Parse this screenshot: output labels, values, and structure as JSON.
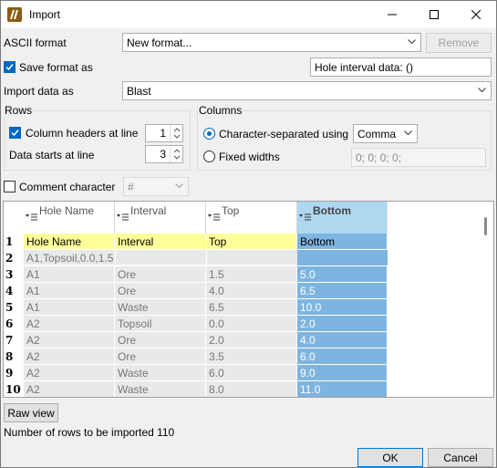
{
  "window": {
    "title": "Import"
  },
  "ascii_format": {
    "label": "ASCII format",
    "value": "New format...",
    "remove_label": "Remove"
  },
  "save_format": {
    "label": "Save format as",
    "checked": true,
    "name_value": "Hole interval data: ()"
  },
  "import_data": {
    "label": "Import data as",
    "value": "Blast"
  },
  "rows": {
    "title": "Rows",
    "column_headers_label": "Column headers at line",
    "column_headers_checked": true,
    "column_headers_value": "1",
    "data_starts_label": "Data starts at line",
    "data_starts_value": "3"
  },
  "columns": {
    "title": "Columns",
    "char_sep_label": "Character-separated using",
    "char_sep_value": "Comma",
    "fixed_widths_label": "Fixed widths",
    "fixed_widths_value": "0; 0; 0; 0;",
    "selected": "character-separated"
  },
  "comment": {
    "label": "Comment character",
    "checked": false,
    "value": "#"
  },
  "grid": {
    "headers": [
      "Hole Name",
      "Interval",
      "Top",
      "Bottom"
    ],
    "selected_column": 3,
    "rows": [
      {
        "n": "1",
        "cells": [
          "Hole Name",
          "Interval",
          "Top",
          "Bottom"
        ],
        "type": "header"
      },
      {
        "n": "2",
        "cells": [
          "A1,Topsoil,0.0,1.5",
          "",
          "",
          ""
        ],
        "type": "raw"
      },
      {
        "n": "3",
        "cells": [
          "A1",
          "Ore",
          "1.5",
          "5.0"
        ],
        "type": "data"
      },
      {
        "n": "4",
        "cells": [
          "A1",
          "Ore",
          "4.0",
          "6.5"
        ],
        "type": "data"
      },
      {
        "n": "5",
        "cells": [
          "A1",
          "Waste",
          "6.5",
          "10.0"
        ],
        "type": "data"
      },
      {
        "n": "6",
        "cells": [
          "A2",
          "Topsoil",
          "0.0",
          "2.0"
        ],
        "type": "data"
      },
      {
        "n": "7",
        "cells": [
          "A2",
          "Ore",
          "2.0",
          "4.0"
        ],
        "type": "data"
      },
      {
        "n": "8",
        "cells": [
          "A2",
          "Ore",
          "3.5",
          "6.0"
        ],
        "type": "data"
      },
      {
        "n": "9",
        "cells": [
          "A2",
          "Waste",
          "6.0",
          "9.0"
        ],
        "type": "data"
      },
      {
        "n": "10",
        "cells": [
          "A2",
          "Waste",
          "8.0",
          "11.0"
        ],
        "type": "data"
      }
    ]
  },
  "raw_view_label": "Raw view",
  "status_text": "Number of rows to be imported 110",
  "ok_label": "OK",
  "cancel_label": "Cancel",
  "colors": {
    "header_row": "#ffff99",
    "raw_row": "#e9e9e9",
    "data_row": "#e9e9e9",
    "selected_col_header": "#add8f0",
    "selected_col_cells": "#7eb4e0",
    "accent": "#0067c0"
  }
}
